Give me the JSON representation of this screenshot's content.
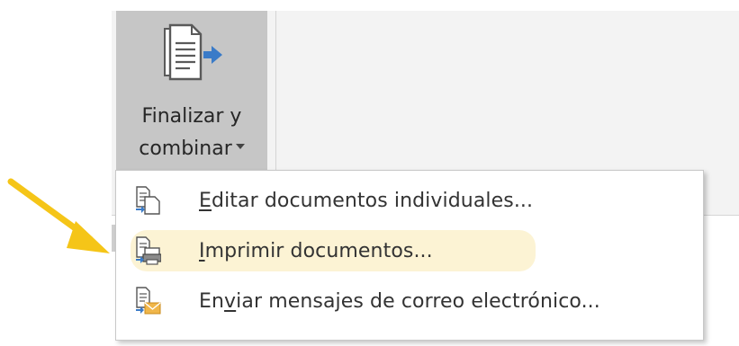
{
  "ribbon_button": {
    "label_line1": "Finalizar y",
    "label_line2": "combinar",
    "icon": "merge-document-icon"
  },
  "menu": {
    "items": [
      {
        "pre": "",
        "key": "E",
        "post": "ditar documentos individuales...",
        "icon": "edit-documents-icon"
      },
      {
        "pre": "",
        "key": "I",
        "post": "mprimir documentos...",
        "icon": "print-documents-icon",
        "highlighted": true
      },
      {
        "pre": "En",
        "key": "v",
        "post": "iar mensajes de correo electrónico...",
        "icon": "email-messages-icon"
      }
    ]
  },
  "colors": {
    "arrow": "#f5c518",
    "hover": "#fcf3d4",
    "pressed_button": "#c6c6c6",
    "accent_blue": "#3a7bc8"
  }
}
